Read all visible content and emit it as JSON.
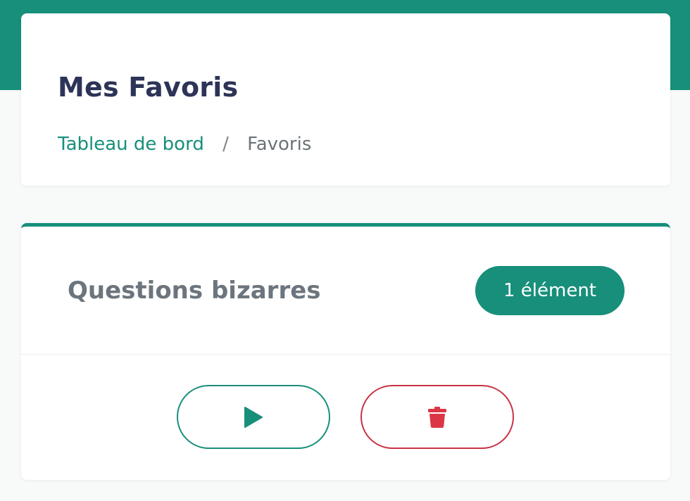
{
  "page": {
    "title": "Mes Favoris"
  },
  "breadcrumb": {
    "home": "Tableau de bord",
    "separator": "/",
    "current": "Favoris"
  },
  "favorites_list": {
    "name": "Questions bizarres",
    "count_badge": "1 élément",
    "actions": {
      "play_icon": "play-icon",
      "delete_icon": "trash-icon"
    }
  },
  "colors": {
    "accent": "#178f7b",
    "title": "#2d3457",
    "muted": "#6c757d",
    "danger": "#dc3545"
  }
}
